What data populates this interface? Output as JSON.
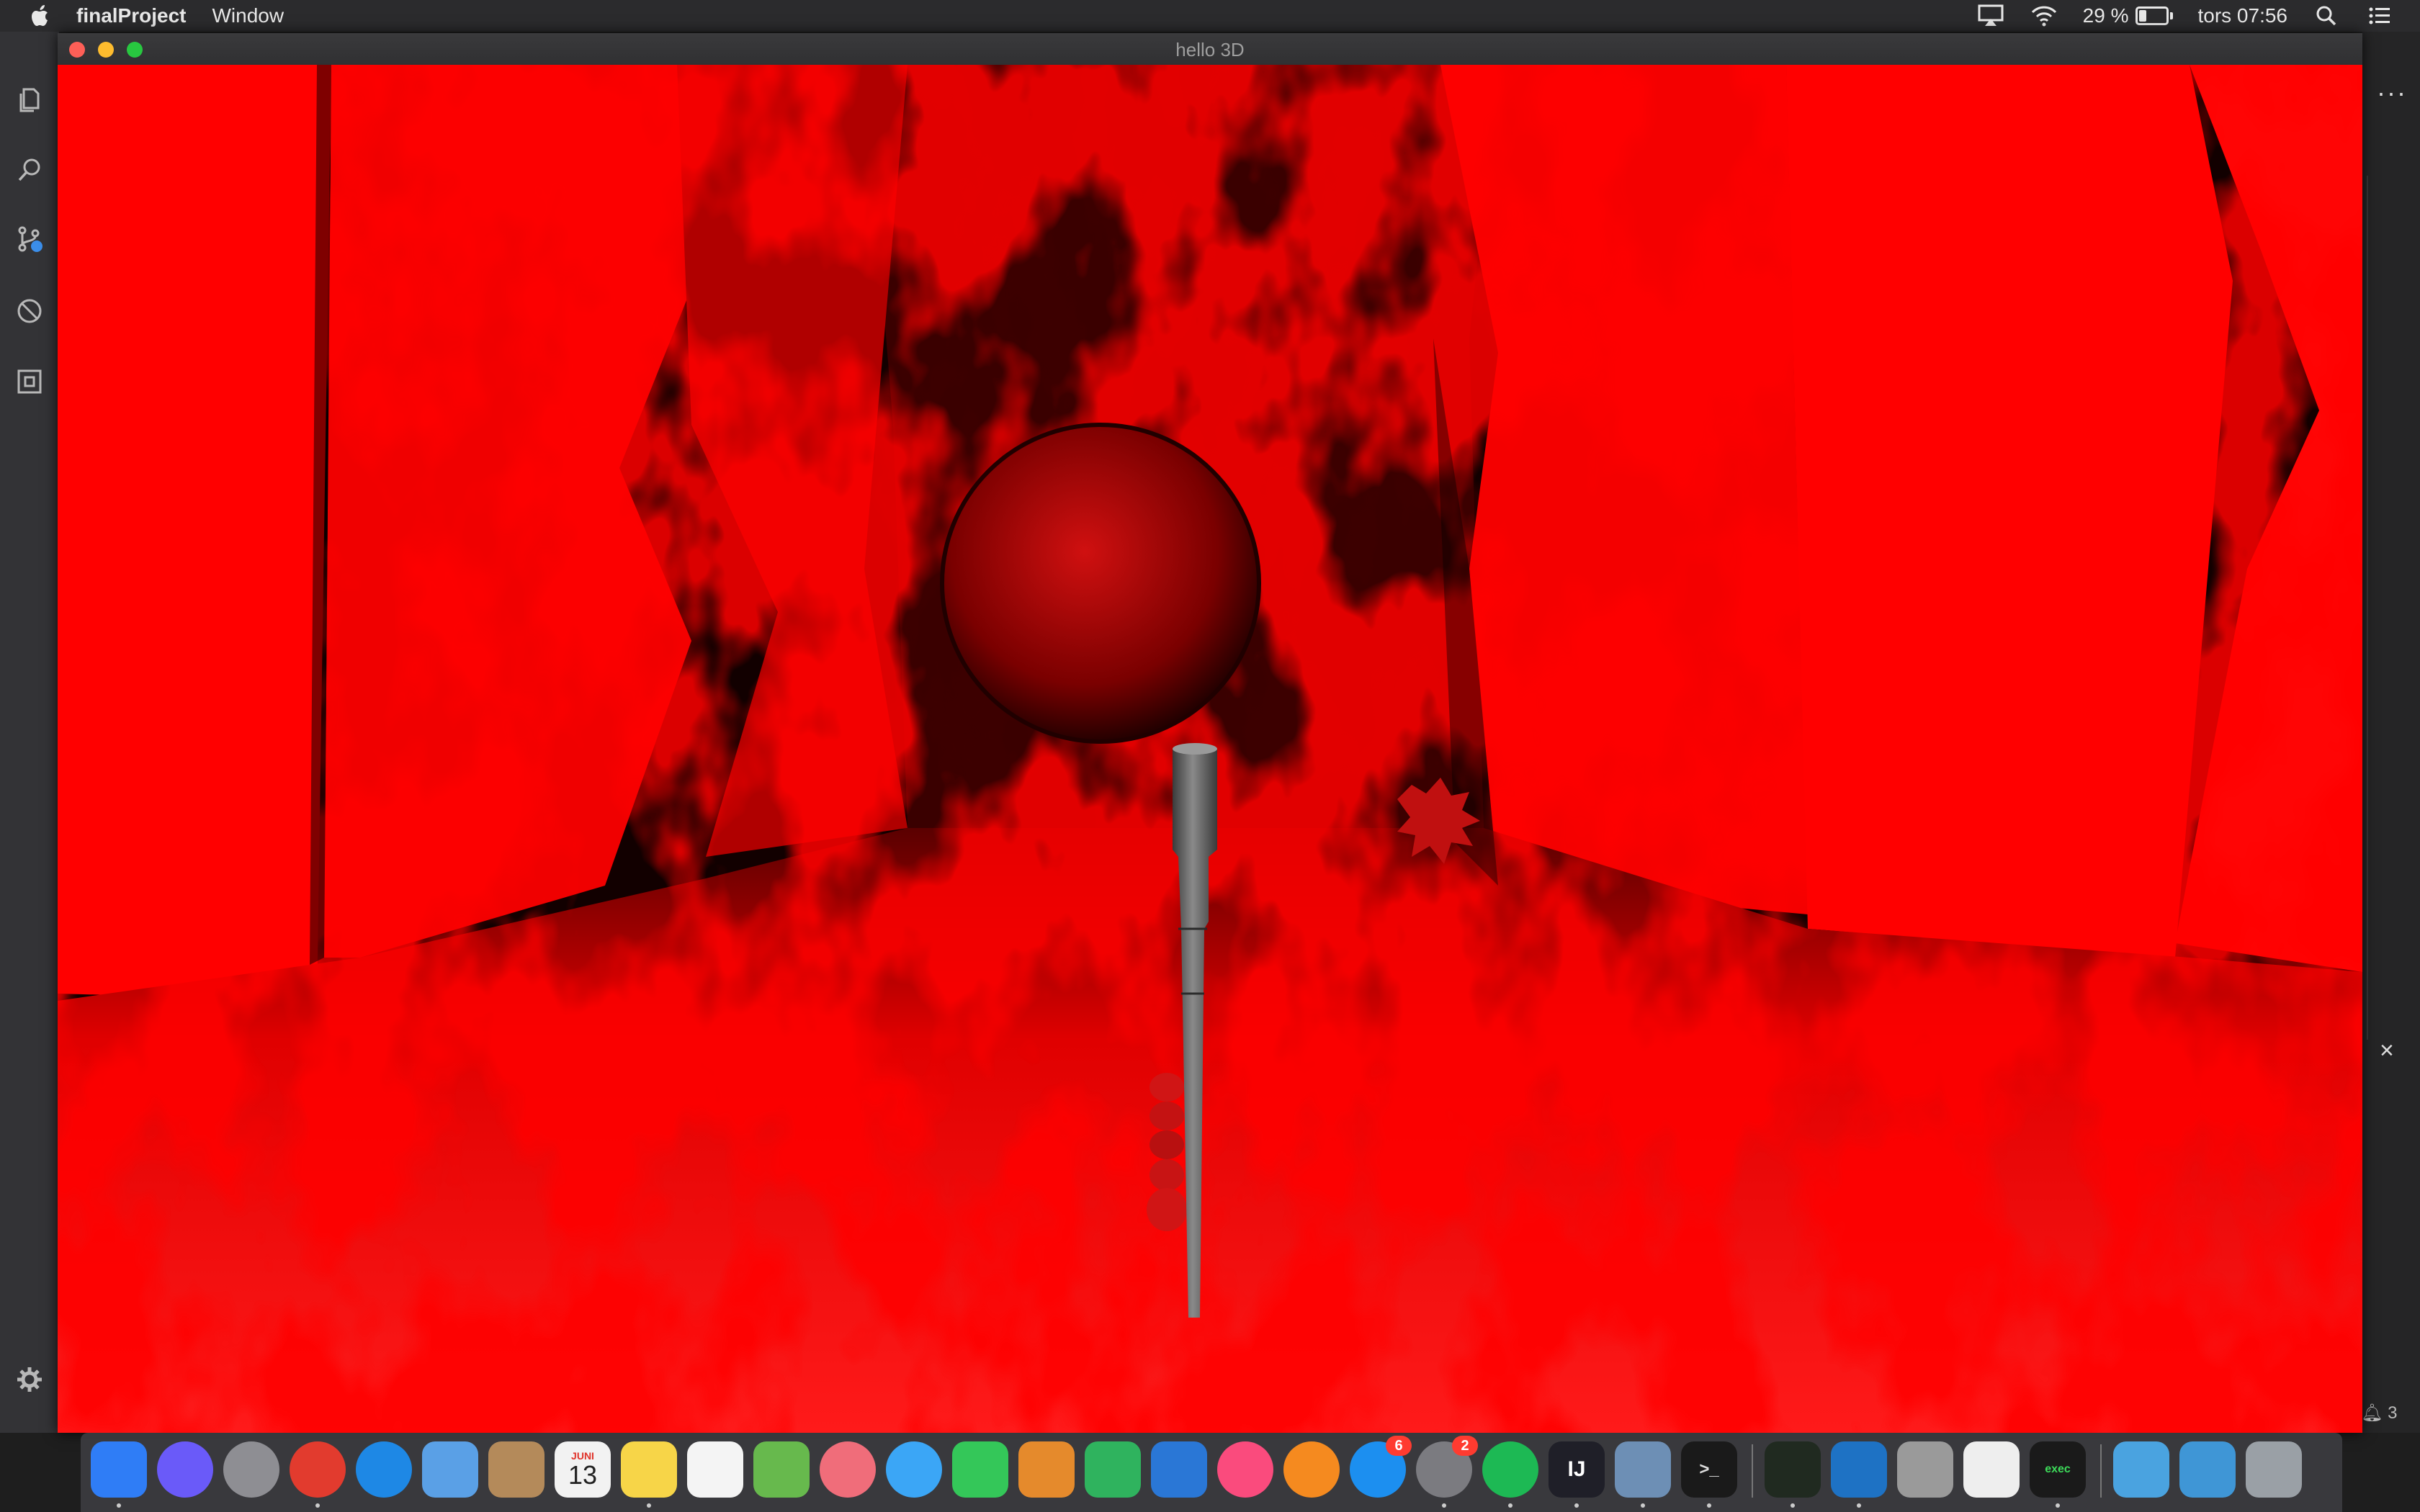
{
  "menubar": {
    "app_name": "finalProject",
    "items": [
      "Window"
    ],
    "battery_text": "29 %",
    "battery_level": 0.29,
    "clock": "tors 07:56"
  },
  "window": {
    "title": "hello 3D"
  },
  "editor": {
    "more_label": "···",
    "close_label": "×",
    "notification_count": "3"
  },
  "dock": {
    "items": [
      {
        "name": "finder",
        "label": "",
        "color": "#2f7df6",
        "round": false,
        "dot": true
      },
      {
        "name": "siri",
        "label": "",
        "color": "#6a5af9",
        "round": true,
        "dot": false
      },
      {
        "name": "launchpad",
        "label": "",
        "color": "#8e8e93",
        "round": true,
        "dot": false
      },
      {
        "name": "chrome",
        "label": "",
        "color": "#e23b2e",
        "round": true,
        "dot": true
      },
      {
        "name": "safari",
        "label": "",
        "color": "#1e88e5",
        "round": true,
        "dot": false
      },
      {
        "name": "mail",
        "label": "",
        "color": "#5aa0e6",
        "round": false,
        "dot": false
      },
      {
        "name": "contacts",
        "label": "",
        "color": "#b48a5a",
        "round": false,
        "dot": false
      },
      {
        "name": "calendar",
        "label": "13",
        "month": "JUNI",
        "color": "#f2f2f2",
        "round": false,
        "dot": false
      },
      {
        "name": "notes",
        "label": "",
        "color": "#f7d548",
        "round": false,
        "dot": true
      },
      {
        "name": "reminders",
        "label": "",
        "color": "#f4f4f4",
        "round": false,
        "dot": false
      },
      {
        "name": "maps",
        "label": "",
        "color": "#67b94d",
        "round": false,
        "dot": false
      },
      {
        "name": "photos",
        "label": "",
        "color": "#f06d7a",
        "round": true,
        "dot": false
      },
      {
        "name": "messages",
        "label": "",
        "color": "#3ba6f6",
        "round": true,
        "dot": false
      },
      {
        "name": "facetime",
        "label": "",
        "color": "#34c759",
        "round": false,
        "dot": false
      },
      {
        "name": "keynote-alt",
        "label": "",
        "color": "#e58a2c",
        "round": false,
        "dot": false
      },
      {
        "name": "numbers",
        "label": "",
        "color": "#2fb35e",
        "round": false,
        "dot": false
      },
      {
        "name": "keynote",
        "label": "",
        "color": "#2a77d6",
        "round": false,
        "dot": false
      },
      {
        "name": "itunes",
        "label": "",
        "color": "#fa4b7d",
        "round": true,
        "dot": false
      },
      {
        "name": "books",
        "label": "",
        "color": "#f58a1f",
        "round": true,
        "dot": false
      },
      {
        "name": "app-store",
        "label": "",
        "color": "#1c8ff0",
        "round": true,
        "dot": false,
        "badge": "6"
      },
      {
        "name": "system-preferences",
        "label": "",
        "color": "#7b7b80",
        "round": true,
        "dot": true,
        "badge": "2"
      },
      {
        "name": "spotify",
        "label": "",
        "color": "#1db954",
        "round": true,
        "dot": true
      },
      {
        "name": "intellij",
        "label": "IJ",
        "color": "#1f1f28",
        "round": false,
        "dot": true
      },
      {
        "name": "preview",
        "label": "",
        "color": "#6d8fb5",
        "round": false,
        "dot": true
      },
      {
        "name": "terminal",
        "label": ">_",
        "color": "#1a1a1a",
        "round": false,
        "dot": true
      },
      {
        "name": "activity-monitor",
        "label": "",
        "color": "#202a20",
        "round": false,
        "dot": true,
        "sep_before": true
      },
      {
        "name": "vscode",
        "label": "",
        "color": "#1e72c4",
        "round": false,
        "dot": true
      },
      {
        "name": "calculator",
        "label": "",
        "color": "#9a9a9a",
        "round": false,
        "dot": false
      },
      {
        "name": "textedit",
        "label": "",
        "color": "#eeeeee",
        "round": false,
        "dot": false
      },
      {
        "name": "exec",
        "label": "exec",
        "color": "#1a1a1a",
        "round": false,
        "dot": true
      },
      {
        "name": "downloads-folder",
        "label": "",
        "color": "#4aa3e0",
        "round": false,
        "dot": false,
        "sep_before": true
      },
      {
        "name": "documents-folder",
        "label": "",
        "color": "#3f96d6",
        "round": false,
        "dot": false
      },
      {
        "name": "trash",
        "label": "",
        "color": "#9aa0a6",
        "round": false,
        "dot": false
      }
    ]
  },
  "colors": {
    "scene_red": "#ff0000",
    "scene_dark": "#1a0000",
    "pole": "#6a6a6a"
  }
}
